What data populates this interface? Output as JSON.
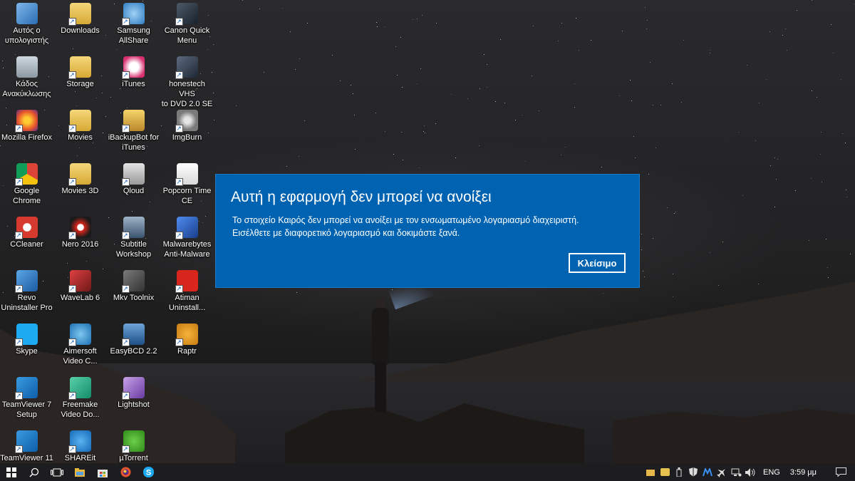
{
  "desktop": {
    "icons": [
      {
        "label": "Αυτός ο\nυπολογιστής",
        "icon": "this-pc-icon",
        "color": "#2a6db5"
      },
      {
        "label": "Κάδος\nΑνακύκλωσης",
        "icon": "recycle-bin-icon",
        "color": "#8c98a2"
      },
      {
        "label": "Mozilla Firefox",
        "icon": "firefox-icon",
        "color": "#e8562b"
      },
      {
        "label": "Google\nChrome",
        "icon": "chrome-icon",
        "color": "#db4437"
      },
      {
        "label": "CCleaner",
        "icon": "ccleaner-icon",
        "color": "#d63a2e"
      },
      {
        "label": "Revo\nUninstaller Pro",
        "icon": "revo-uninstaller-icon",
        "color": "#1d5aa0"
      },
      {
        "label": "Skype",
        "icon": "skype-icon",
        "color": "#1eaaf1"
      },
      {
        "label": "TeamViewer 7\nSetup",
        "icon": "teamviewer-setup-icon",
        "color": "#0d5ea8"
      },
      {
        "label": "TeamViewer 11",
        "icon": "teamviewer-icon",
        "color": "#0d5ea8"
      },
      {
        "label": "Downloads",
        "icon": "folder-icon",
        "color": "#d7a935"
      },
      {
        "label": "Storage",
        "icon": "folder-icon",
        "color": "#d7a935"
      },
      {
        "label": "Movies",
        "icon": "folder-icon",
        "color": "#d7a935"
      },
      {
        "label": "Movies 3D",
        "icon": "folder-icon",
        "color": "#d7a935"
      },
      {
        "label": "Nero 2016",
        "icon": "nero-icon",
        "color": "#d9261c"
      },
      {
        "label": "WaveLab 6",
        "icon": "wavelab-icon",
        "color": "#e04040"
      },
      {
        "label": "Aimersoft\nVideo C...",
        "icon": "aimersoft-icon",
        "color": "#1b6fb2"
      },
      {
        "label": "Freemake\nVideo Do...",
        "icon": "freemake-icon",
        "color": "#138c6b"
      },
      {
        "label": "SHAREit",
        "icon": "shareit-icon",
        "color": "#1568b8"
      },
      {
        "label": "Samsung\nAllShare",
        "icon": "allshare-icon",
        "color": "#2f7bc1"
      },
      {
        "label": "iTunes",
        "icon": "itunes-icon",
        "color": "#d92e6f"
      },
      {
        "label": "iBackupBot for\niTunes",
        "icon": "ibackupbot-icon",
        "color": "#b9882a"
      },
      {
        "label": "Qloud",
        "icon": "qloud-icon",
        "color": "#9a9a9a"
      },
      {
        "label": "Subtitle\nWorkshop",
        "icon": "subtitle-workshop-icon",
        "color": "#3a556f"
      },
      {
        "label": "Mkv Toolnix",
        "icon": "mkvtoolnix-icon",
        "color": "#333333"
      },
      {
        "label": "EasyBCD 2.2",
        "icon": "easybcd-icon",
        "color": "#1e4f86"
      },
      {
        "label": "Lightshot",
        "icon": "lightshot-icon",
        "color": "#6b3aa1"
      },
      {
        "label": "µTorrent",
        "icon": "utorrent-icon",
        "color": "#2e8a1a"
      },
      {
        "label": "Canon Quick\nMenu",
        "icon": "canon-quick-menu-icon",
        "color": "#18202a"
      },
      {
        "label": "honestech VHS\nto DVD 2.0 SE",
        "icon": "honestech-icon",
        "color": "#1e2733"
      },
      {
        "label": "ImgBurn",
        "icon": "imgburn-icon",
        "color": "#7a7a7a"
      },
      {
        "label": "Popcorn Time\nCE",
        "icon": "popcorn-time-icon",
        "color": "#d9d9d9"
      },
      {
        "label": "Malwarebytes\nAnti-Malware",
        "icon": "malwarebytes-icon",
        "color": "#1a3e8c"
      },
      {
        "label": "Atiman\nUninstall...",
        "icon": "atiman-icon",
        "color": "#d9261c"
      },
      {
        "label": "Raptr",
        "icon": "raptr-icon",
        "color": "#c77a12"
      }
    ]
  },
  "dialog": {
    "title": "Αυτή η εφαρμογή δεν μπορεί να ανοίξει",
    "message_line1": "Το στοιχείο Καιρός δεν μπορεί να ανοίξει με τον ενσωματωμένο λογαριασμό διαχειριστή.",
    "message_line2": "Εισέλθετε με διαφορετικό λογαριασμό και δοκιμάστε ξανά.",
    "close_label": "Κλείσιμο",
    "background": "#0063b1"
  },
  "taskbar": {
    "buttons": [
      "start-icon",
      "search-icon",
      "task-view-icon"
    ],
    "pinned_apps": [
      "file-explorer-icon",
      "store-icon",
      "firefox-icon",
      "skype-icon"
    ],
    "tray_icons": [
      "folder-tray-icon",
      "onedrive-icon",
      "usb-icon",
      "shield-icon",
      "malwarebytes-tray-icon",
      "airplane-icon",
      "network-icon",
      "volume-icon"
    ],
    "language": "ENG",
    "time": "3:59 μμ",
    "notifications_icon": "action-center-icon"
  }
}
